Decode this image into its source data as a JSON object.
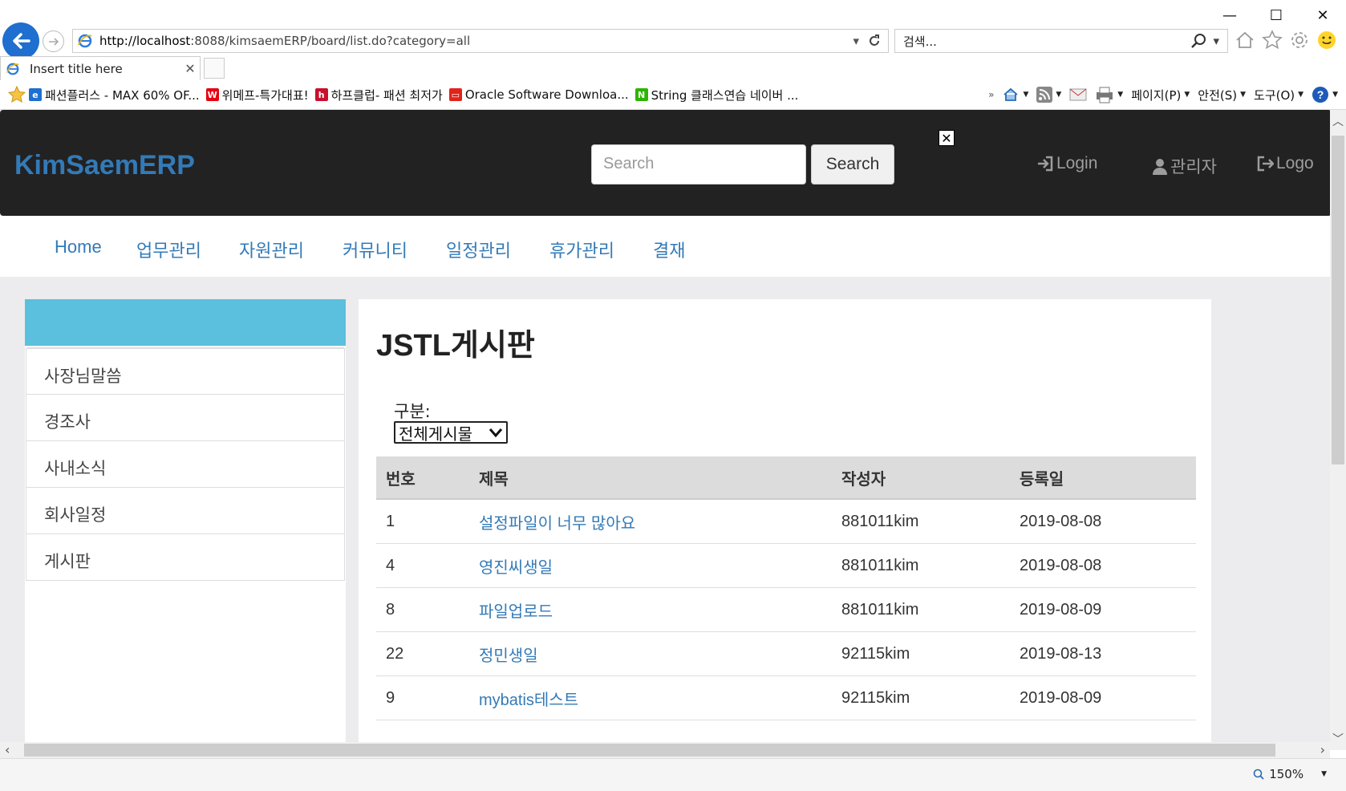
{
  "browser": {
    "window_minimize": "—",
    "window_maximize": "☐",
    "window_close": "✕",
    "url_host": "http://localhost",
    "url_rest": ":8088/kimsaemERP/board/list.do?category=all",
    "search_placeholder": "검색...",
    "tab_title": "Insert title here",
    "favorites": [
      {
        "label": "패션플러스 - MAX 60% OF...",
        "icon_color": "#1e6fcf",
        "glyph": "e"
      },
      {
        "label": "위메프-특가대표!",
        "icon_color": "#e60012",
        "glyph": "W"
      },
      {
        "label": "하프클럽- 패션 최저가",
        "icon_color": "#c8102e",
        "glyph": "h"
      },
      {
        "label": "Oracle Software Downloa...",
        "icon_color": "#e2231a",
        "glyph": "▭"
      },
      {
        "label": "String 클래스연습  네이버 ...",
        "icon_color": "#2db400",
        "glyph": "N"
      }
    ],
    "commands": {
      "page": "페이지(P)",
      "safety": "안전(S)",
      "tools": "도구(O)"
    },
    "zoom": "150%"
  },
  "site": {
    "brand": "KimSaemERP",
    "search_placeholder": "Search",
    "search_button": "Search",
    "nav_login": "Login",
    "nav_admin": "관리자",
    "nav_logout": "Logo",
    "menu": [
      "Home",
      "업무관리",
      "자원관리",
      "커뮤니티",
      "일정관리",
      "휴가관리",
      "결재"
    ],
    "sidebar": [
      "사장님말씀",
      "경조사",
      "사내소식",
      "회사일정",
      "게시판"
    ]
  },
  "board": {
    "title": "JSTL게시판",
    "category_label": "구분:",
    "category_value": "전체게시물",
    "headers": [
      "번호",
      "제목",
      "작성자",
      "등록일"
    ],
    "rows": [
      {
        "no": "1",
        "title": "설정파일이 너무 많아요",
        "author": "881011kim",
        "date": "2019-08-08"
      },
      {
        "no": "4",
        "title": "영진씨생일",
        "author": "881011kim",
        "date": "2019-08-08"
      },
      {
        "no": "8",
        "title": "파일업로드",
        "author": "881011kim",
        "date": "2019-08-09"
      },
      {
        "no": "22",
        "title": "정민생일",
        "author": "92115kim",
        "date": "2019-08-13"
      },
      {
        "no": "9",
        "title": "mybatis테스트",
        "author": "92115kim",
        "date": "2019-08-09"
      }
    ]
  },
  "colors": {
    "link": "#337ab7",
    "navbar_bg": "#222222",
    "sidebar_head": "#5bc0de"
  }
}
